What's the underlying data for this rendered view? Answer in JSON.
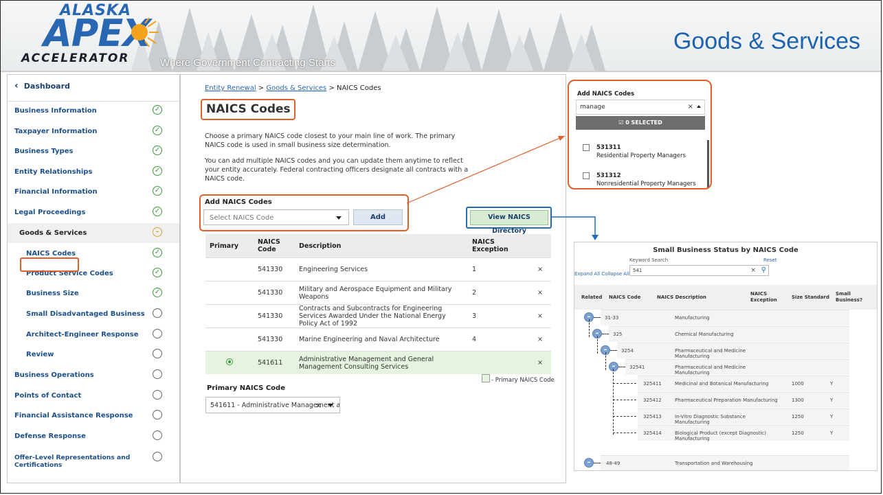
{
  "header": {
    "logo_alaska": "ALASKA",
    "logo_apex": "APEX",
    "logo_accelerator": "ACCELERATOR",
    "tagline": "Where Government Contracting Starts",
    "slide_title": "Goods & Services"
  },
  "sidebar": {
    "dashboard_label": "Dashboard",
    "items": [
      {
        "label": "Business Information",
        "status": "done"
      },
      {
        "label": "Taxpayer Information",
        "status": "done"
      },
      {
        "label": "Business Types",
        "status": "done"
      },
      {
        "label": "Entity Relationships",
        "status": "done"
      },
      {
        "label": "Financial Information",
        "status": "done"
      },
      {
        "label": "Legal Proceedings",
        "status": "done"
      },
      {
        "label": "Goods & Services",
        "status": "in-progress"
      },
      {
        "label": "NAICS Codes",
        "status": "done"
      },
      {
        "label": "Product Service Codes",
        "status": "done"
      },
      {
        "label": "Business Size",
        "status": "done"
      },
      {
        "label": "Small Disadvantaged Business",
        "status": "none"
      },
      {
        "label": "Architect-Engineer Response",
        "status": "none"
      },
      {
        "label": "Review",
        "status": "none"
      },
      {
        "label": "Business Operations",
        "status": "none"
      },
      {
        "label": "Points of Contact",
        "status": "none"
      },
      {
        "label": "Financial Assistance Response",
        "status": "none"
      },
      {
        "label": "Defense Response",
        "status": "none"
      },
      {
        "label": "Offer-Level Representations and Certifications",
        "status": "none"
      }
    ]
  },
  "main": {
    "breadcrumb": {
      "link1": "Entity Renewal",
      "sep": " > ",
      "link2": "Goods & Services",
      "current": "NAICS Codes"
    },
    "heading": "NAICS Codes",
    "para1": "Choose a primary NAICS code closest to your main line of work. The primary NAICS code is used in small business size determination.",
    "para2": "You can add multiple NAICS codes and you can update them anytime to reflect your entity accurately. Federal contracting officers designate all contracts with a NAICS code.",
    "add_label": "Add NAICS Codes",
    "select_placeholder": "Select NAICS Code",
    "add_button": "Add",
    "directory_button": "View NAICS Directory",
    "table": {
      "headers": [
        "Primary",
        "NAICS Code",
        "Description",
        "NAICS Exception",
        ""
      ],
      "rows": [
        {
          "code": "541330",
          "desc": "Engineering Services",
          "exception": "1",
          "primary": false
        },
        {
          "code": "541330",
          "desc": "Military and Aerospace Equipment and Military Weapons",
          "exception": "2",
          "primary": false
        },
        {
          "code": "541330",
          "desc": "Contracts and Subcontracts for Engineering Services Awarded Under the National Energy Policy Act of 1992",
          "exception": "3",
          "primary": false
        },
        {
          "code": "541330",
          "desc": "Marine Engineering and Naval Architecture",
          "exception": "4",
          "primary": false
        },
        {
          "code": "541611",
          "desc": "Administrative Management and General Management Consulting Services",
          "exception": "",
          "primary": true
        }
      ],
      "remove_symbol": "×"
    },
    "legend": "- Primary NAICS Code",
    "primary_label": "Primary NAICS Code",
    "primary_value": "541611 - Administrative Management a"
  },
  "dropdown": {
    "title": "Add NAICS Codes",
    "query": "manage",
    "selected_bar": "☑ 0 SELECTED",
    "options": [
      {
        "code": "531311",
        "desc": "Residential Property Managers"
      },
      {
        "code": "531312",
        "desc": "Nonresidential Property Managers"
      }
    ]
  },
  "small_business": {
    "title": "Small Business Status by NAICS Code",
    "keyword_label": "Keyword Search",
    "reset": "Reset",
    "expand_collapse": "Expand All  Collapse All",
    "search_value": "541",
    "headers": [
      "Related",
      "NAICS Code",
      "NAICS Description",
      "NAICS Exception",
      "Size Standard",
      "Small Business?"
    ],
    "rows": [
      {
        "code": "31-33",
        "desc": "Manufacturing",
        "size": "",
        "sb": ""
      },
      {
        "code": "325",
        "desc": "Chemical Manufacturing",
        "size": "",
        "sb": ""
      },
      {
        "code": "3254",
        "desc": "Pharmaceutical and Medicine Manufacturing",
        "size": "",
        "sb": ""
      },
      {
        "code": "32541",
        "desc": "Pharmaceutical and Medicine Manufacturing",
        "size": "",
        "sb": ""
      },
      {
        "code": "325411",
        "desc": "Medicinal and Botanical Manufacturing",
        "size": "1000",
        "sb": "Y"
      },
      {
        "code": "325412",
        "desc": "Pharmaceutical Preparation Manufacturing",
        "size": "1300",
        "sb": "Y"
      },
      {
        "code": "325413",
        "desc": "In-Vitro Diagnostic Substance Manufacturing",
        "size": "1250",
        "sb": "Y"
      },
      {
        "code": "325414",
        "desc": "Biological Product (except Diagnostic) Manufacturing",
        "size": "1250",
        "sb": "Y"
      },
      {
        "code": "48-49",
        "desc": "Transportation and Warehousing",
        "size": "",
        "sb": ""
      }
    ]
  },
  "colors": {
    "accent_orange": "#e0602a",
    "accent_blue": "#1f6db5",
    "title_blue": "#1e63ae",
    "done_green": "#3a9a3a",
    "progress_amber": "#d8a640"
  }
}
